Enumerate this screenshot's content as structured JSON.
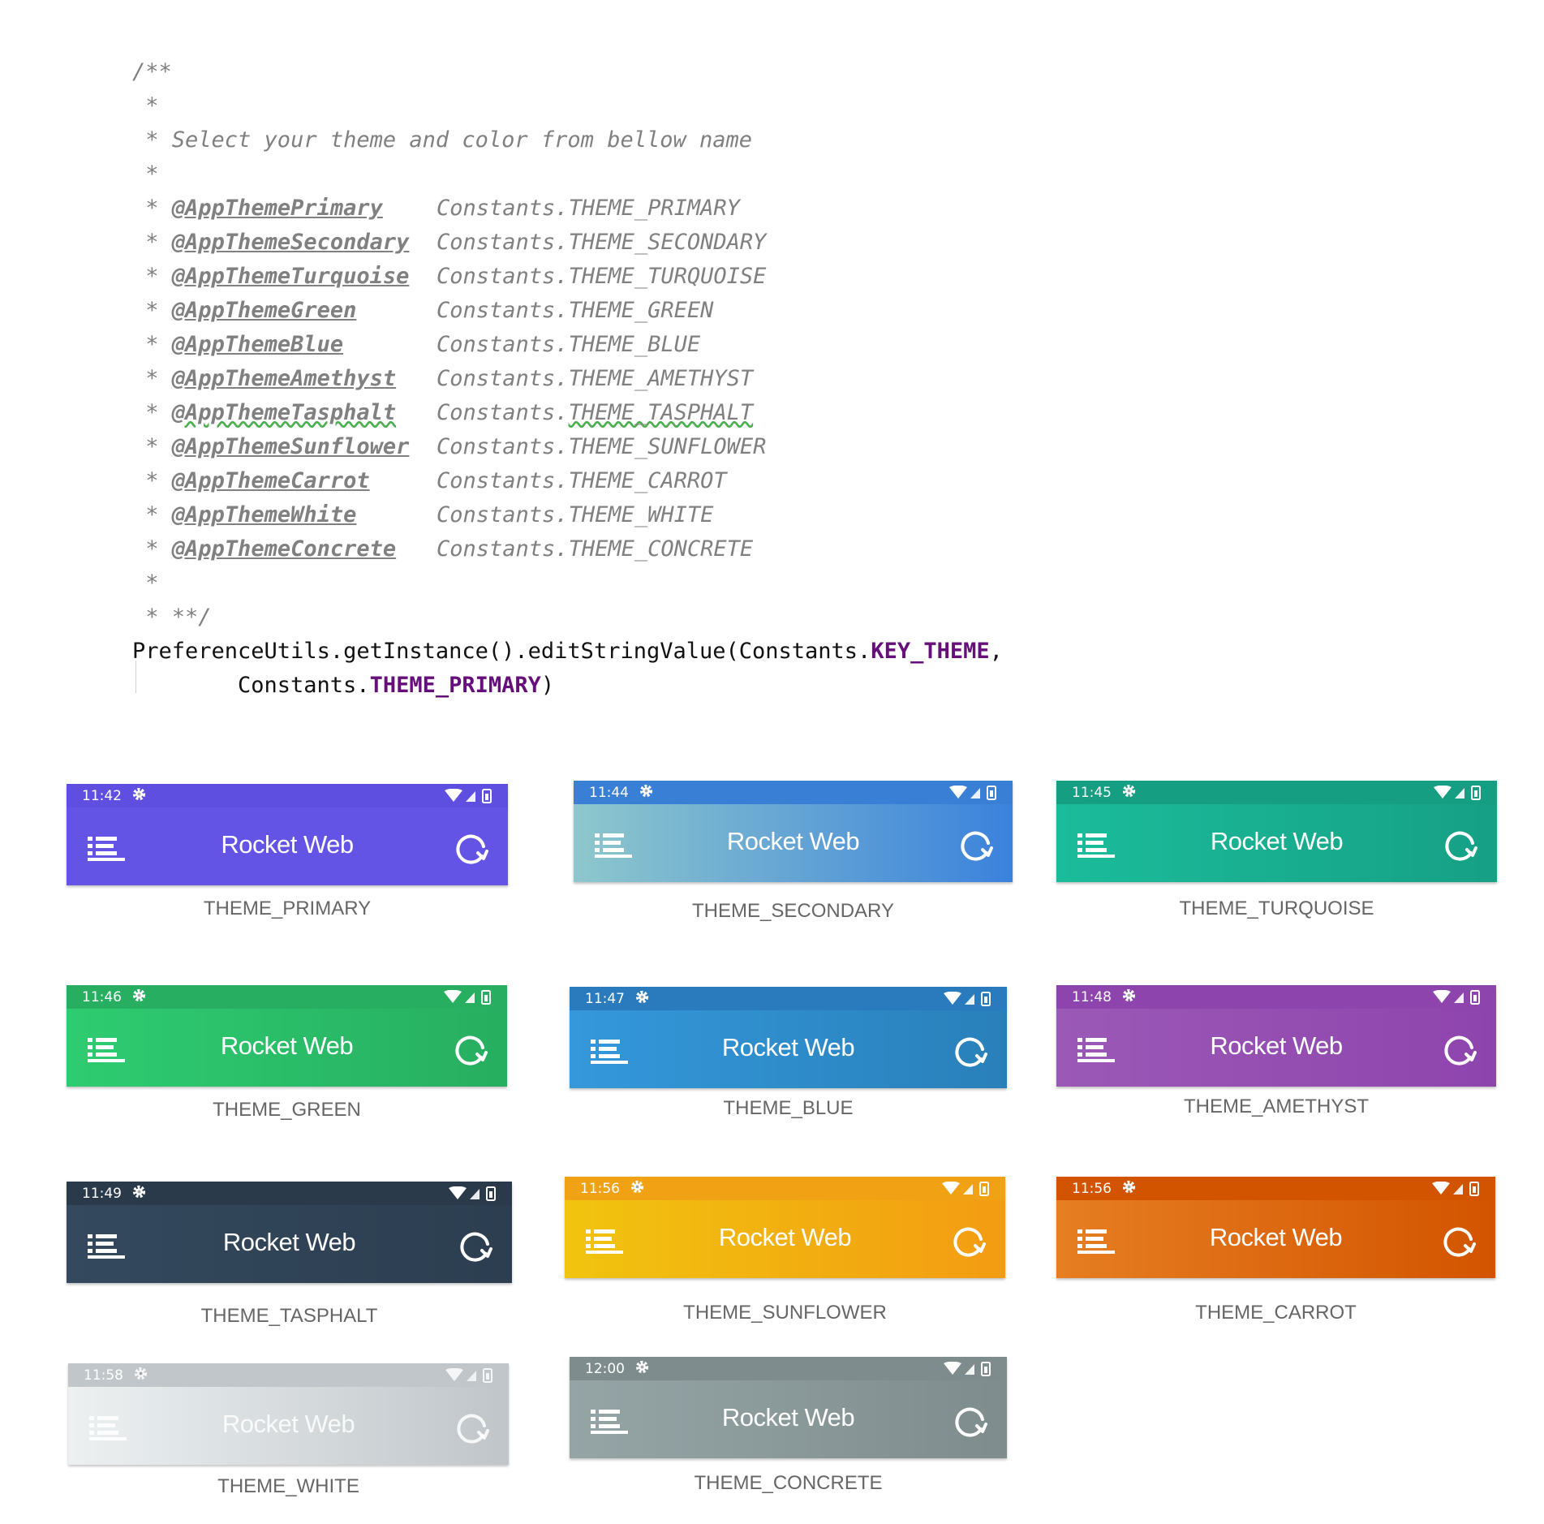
{
  "code": {
    "comment_open": "/**",
    "star": " *",
    "description": " * Select your theme and color from bellow name",
    "themes": [
      {
        "tag": "@AppThemePrimary",
        "constant_prefix": "Constants.",
        "constant": "THEME_PRIMARY"
      },
      {
        "tag": "@AppThemeSecondary",
        "constant_prefix": "Constants.",
        "constant": "THEME_SECONDARY"
      },
      {
        "tag": "@AppThemeTurquoise",
        "constant_prefix": "Constants.",
        "constant": "THEME_TURQUOISE"
      },
      {
        "tag": "@AppThemeGreen",
        "constant_prefix": "Constants.",
        "constant": "THEME_GREEN"
      },
      {
        "tag": "@AppThemeBlue",
        "constant_prefix": "Constants.",
        "constant": "THEME_BLUE"
      },
      {
        "tag": "@AppThemeAmethyst",
        "constant_prefix": "Constants.",
        "constant": "THEME_AMETHYST"
      },
      {
        "tag": "@AppThemeTasphalt",
        "constant_prefix": "Constants.",
        "constant": "THEME_TASPHALT"
      },
      {
        "tag": "@AppThemeSunflower",
        "constant_prefix": "Constants.",
        "constant": "THEME_SUNFLOWER"
      },
      {
        "tag": "@AppThemeCarrot",
        "constant_prefix": "Constants.",
        "constant": "THEME_CARROT"
      },
      {
        "tag": "@AppThemeWhite",
        "constant_prefix": "Constants.",
        "constant": "THEME_WHITE"
      },
      {
        "tag": "@AppThemeConcrete",
        "constant_prefix": "Constants.",
        "constant": "THEME_CONCRETE"
      }
    ],
    "comment_close": " * **/",
    "statement_line1_prefix": "PreferenceUtils.getInstance().editStringValue(Constants.",
    "statement_line1_key": "KEY_THEME",
    "statement_line1_suffix": ",",
    "statement_line2_prefix": "Constants.",
    "statement_line2_value": "THEME_PRIMARY",
    "statement_line2_suffix": ")",
    "colors": {
      "comment": "#808080",
      "keyword": "#660e7a",
      "text": "#111111"
    }
  },
  "app_title": "Rocket Web",
  "cards": [
    {
      "time": "11:42",
      "caption": "THEME_PRIMARY",
      "status_color": "#5f4fe0",
      "bar_from": "#6454e6",
      "bar_to": "#6454e6",
      "faded": false
    },
    {
      "time": "11:44",
      "caption": "THEME_SECONDARY",
      "status_color": "#3a7fd6",
      "bar_from": "#8ec7cc",
      "bar_to": "#3b82dc",
      "faded": false
    },
    {
      "time": "11:45",
      "caption": "THEME_TURQUOISE",
      "status_color": "#169e82",
      "bar_from": "#1bbc9b",
      "bar_to": "#16a085",
      "faded": false
    },
    {
      "time": "11:46",
      "caption": "THEME_GREEN",
      "status_color": "#27ae60",
      "bar_from": "#2ecc71",
      "bar_to": "#27ae60",
      "faded": false
    },
    {
      "time": "11:47",
      "caption": "THEME_BLUE",
      "status_color": "#2a7bbd",
      "bar_from": "#3498db",
      "bar_to": "#2980b9",
      "faded": false
    },
    {
      "time": "11:48",
      "caption": "THEME_AMETHYST",
      "status_color": "#8e44ad",
      "bar_from": "#9b59b6",
      "bar_to": "#8e44ad",
      "faded": false
    },
    {
      "time": "11:49",
      "caption": "THEME_TASPHALT",
      "status_color": "#2a3a4b",
      "bar_from": "#34495e",
      "bar_to": "#2c3e50",
      "faded": false
    },
    {
      "time": "11:56",
      "caption": "THEME_SUNFLOWER",
      "status_color": "#f0a114",
      "bar_from": "#f1c40f",
      "bar_to": "#f39c12",
      "faded": false
    },
    {
      "time": "11:56",
      "caption": "THEME_CARROT",
      "status_color": "#d35400",
      "bar_from": "#e67e22",
      "bar_to": "#d35400",
      "faded": false
    },
    {
      "time": "11:58",
      "caption": "THEME_WHITE",
      "status_color": "#bdc3c7",
      "bar_from": "#ecf0f1",
      "bar_to": "#bdc3c7",
      "faded": true
    },
    {
      "time": "12:00",
      "caption": "THEME_CONCRETE",
      "status_color": "#7f8c8d",
      "bar_from": "#95a5a6",
      "bar_to": "#7f8c8d",
      "faded": false
    }
  ]
}
